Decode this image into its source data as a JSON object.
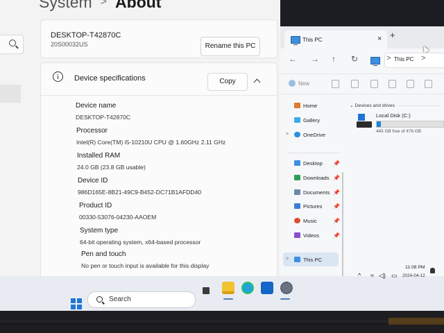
{
  "settings": {
    "breadcrumb": {
      "parent": "System",
      "separator": ">",
      "current": "About"
    },
    "device_card": {
      "name": "DESKTOP-T42870C",
      "serial": "20S00032US",
      "rename_label": "Rename this PC"
    },
    "specs": {
      "title": "Device specifications",
      "copy_label": "Copy",
      "rows": [
        {
          "label": "Device name",
          "value": "DESKTOP-T42870C"
        },
        {
          "label": "Processor",
          "value": "Intel(R) Core(TM) i5-10210U CPU @ 1.60GHz   2.11 GHz"
        },
        {
          "label": "Installed RAM",
          "value": "24.0 GB (23.8 GB usable)"
        },
        {
          "label": "Device ID",
          "value": "986D165E-8B21-49C9-B452-DC71B1AFDD40"
        },
        {
          "label": "Product ID",
          "value": "00330-53076-04230-AAOEM"
        },
        {
          "label": "System type",
          "value": "64-bit operating system, x64-based processor"
        },
        {
          "label": "Pen and touch",
          "value": "No pen or touch input is available for this display"
        }
      ]
    }
  },
  "explorer": {
    "tab_title": "This PC",
    "tab_close": "×",
    "tab_new": "+",
    "nav_glyphs": [
      "←",
      "→",
      "↑",
      "↻"
    ],
    "address": {
      "sep": ">",
      "path": "This PC",
      "sep2": ">"
    },
    "new_label": "New",
    "nav_items": {
      "home": "Home",
      "gallery": "Gallery",
      "onedrive": "OneDrive",
      "desktop": "Desktop",
      "downloads": "Downloads",
      "documents": "Documents",
      "pictures": "Pictures",
      "music": "Music",
      "videos": "Videos",
      "thispc": "This PC"
    },
    "pin_glyph": "📌",
    "group_header": "Devices and drives",
    "drive": {
      "name": "Local Disk (C:)",
      "free_text": "445 GB free of 476 GB",
      "used_fraction": 0.065
    }
  },
  "taskbar": {
    "search_label": "Search",
    "tray": {
      "chevron": "^",
      "wifi": "≈",
      "volume": "◁)",
      "battery": "▭",
      "time": "11:08 PM",
      "date": "2024-04-12"
    }
  },
  "colors": {
    "accent": "#1f73d8",
    "settings_bg": "#f3f3f3",
    "card_bg": "#fbfbfb",
    "taskbar_bg": "#e8ecf2"
  },
  "icons": [
    "search-icon",
    "info-icon",
    "chevron-up-icon",
    "this-pc-icon",
    "windows-start-icon",
    "file-explorer-icon",
    "edge-icon",
    "store-icon",
    "settings-gear-icon",
    "wifi-icon",
    "volume-icon",
    "battery-icon",
    "notification-icon"
  ]
}
